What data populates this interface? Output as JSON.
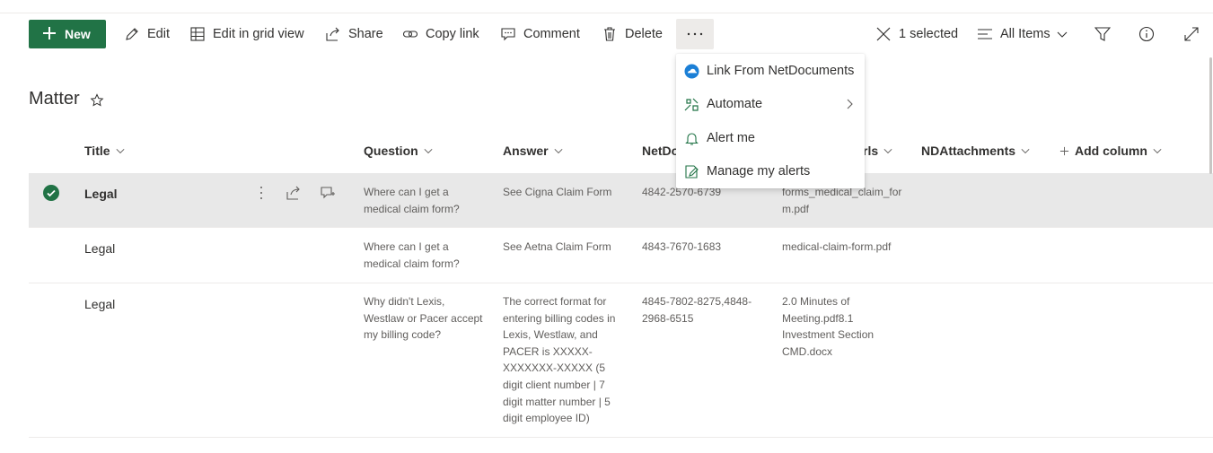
{
  "colors": {
    "accent": "#217346",
    "selected_row": "#e8e8e8",
    "text": "#323130",
    "muted": "#605e5c"
  },
  "command_bar": {
    "new_label": "New",
    "edit_label": "Edit",
    "grid_label": "Edit in grid view",
    "share_label": "Share",
    "copy_link_label": "Copy link",
    "comment_label": "Comment",
    "delete_label": "Delete",
    "more_label": "···",
    "selected_label": "1 selected",
    "view_label": "All Items"
  },
  "list": {
    "title": "Matter",
    "columns": {
      "title": "Title",
      "question": "Question",
      "answer": "Answer",
      "netdocs": "NetDo",
      "urls": "rls",
      "ndattachments": "NDAttachments",
      "add_column": "Add column"
    },
    "rows": [
      {
        "title": "Legal",
        "question": [
          "Where can I get a",
          "medical claim form?"
        ],
        "answer": [
          "See Cigna Claim Form"
        ],
        "netdocs": [
          "4842-2570-6739"
        ],
        "urls": [
          "forms_medical_claim_for",
          "m.pdf"
        ]
      },
      {
        "title": "Legal",
        "question": [
          "Where can I get a",
          "medical claim form?"
        ],
        "answer": [
          "See Aetna Claim Form"
        ],
        "netdocs": [
          "4843-7670-1683"
        ],
        "urls": [
          "medical-claim-form.pdf"
        ]
      },
      {
        "title": "Legal",
        "question": [
          "Why didn't Lexis,",
          "Westlaw or Pacer accept",
          "my billing code?"
        ],
        "answer": [
          "The correct format for",
          "entering billing codes in",
          "Lexis, Westlaw, and",
          "PACER is XXXXX-",
          "XXXXXXX-XXXXX (5",
          "digit client number | 7",
          "digit matter number | 5",
          "digit employee ID)"
        ],
        "netdocs": [
          "4845-7802-8275,4848-",
          "2968-6515"
        ],
        "urls": [
          "2.0 Minutes of",
          "Meeting.pdf8.1",
          "Investment Section",
          "CMD.docx"
        ]
      }
    ]
  },
  "menu": {
    "items": [
      {
        "label": "Link From NetDocuments",
        "icon": "netdocuments-icon"
      },
      {
        "label": "Automate",
        "icon": "automate-icon",
        "submenu": true
      },
      {
        "label": "Alert me",
        "icon": "bell-icon"
      },
      {
        "label": "Manage my alerts",
        "icon": "manage-alerts-icon"
      }
    ]
  }
}
